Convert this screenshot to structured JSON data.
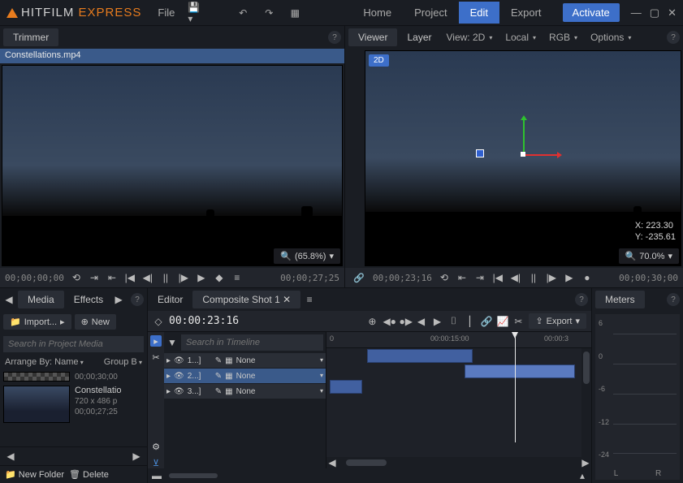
{
  "app": {
    "name_a": "HITFILM ",
    "name_b": "EXPRESS"
  },
  "menu": {
    "file": "File"
  },
  "workspace": {
    "home": "Home",
    "project": "Project",
    "edit": "Edit",
    "export": "Export"
  },
  "activate": "Activate",
  "trimmer": {
    "tab": "Trimmer",
    "clip": "Constellations.mp4",
    "zoom": "(65.8%)",
    "tc_start": "00;00;00;00",
    "tc_end": "00;00;27;25"
  },
  "viewer": {
    "tab_viewer": "Viewer",
    "tab_layer": "Layer",
    "view_mode": "View: 2D",
    "space": "Local",
    "channel": "RGB",
    "options": "Options",
    "badge": "2D",
    "coords_x": "X:   223.30",
    "coords_y": "Y:  -235.61",
    "zoom": "70.0%",
    "tc_start": "00;00;23;16",
    "tc_end": "00;00;30;00"
  },
  "media": {
    "tab_media": "Media",
    "tab_effects": "Effects",
    "import": "Import...",
    "new": "New",
    "search_ph": "Search in Project Media",
    "arrange": "Arrange By: Name",
    "group": "Group B",
    "item0_dur": "00;00;30;00",
    "item1_name": "Constellatio",
    "item1_res": "720 x 486 p",
    "item1_dur": "00;00;27;25",
    "new_folder": "New Folder",
    "delete": "Delete"
  },
  "editor": {
    "tab_editor": "Editor",
    "tab_comp": "Composite Shot 1",
    "timecode": "00:00:23:16",
    "export": "Export",
    "search_ph": "Search in Timeline",
    "ruler0": "0",
    "ruler1": "00:00:15:00",
    "ruler2": "00:00:3",
    "tracks": [
      {
        "name": "1...]",
        "mode": "None"
      },
      {
        "name": "2...]",
        "mode": "None"
      },
      {
        "name": "3...]",
        "mode": "None"
      }
    ]
  },
  "meters": {
    "tab": "Meters",
    "scale": [
      "6",
      "0",
      "-6",
      "-12",
      "-24"
    ],
    "L": "L",
    "R": "R"
  }
}
